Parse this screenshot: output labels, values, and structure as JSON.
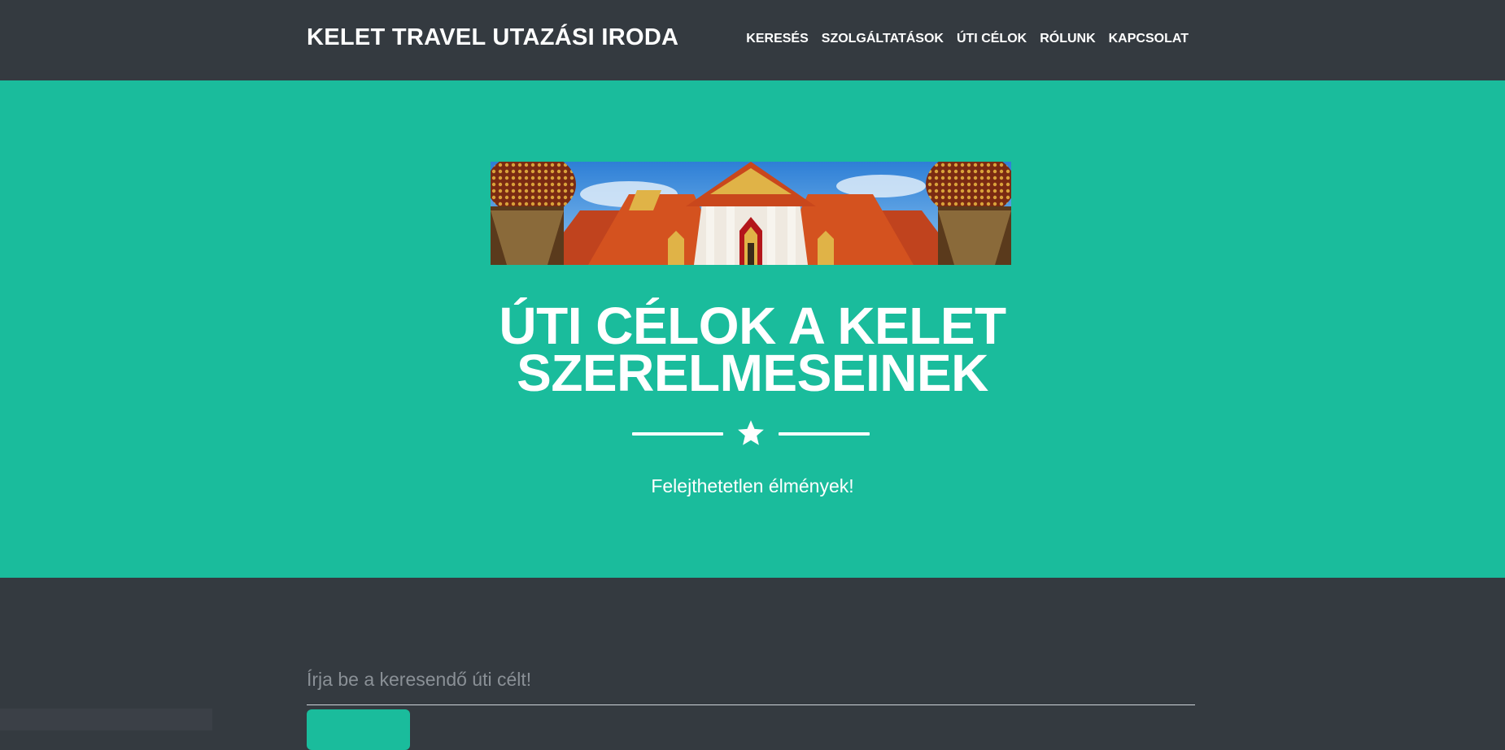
{
  "navbar": {
    "brand": "KELET TRAVEL UTAZÁSI IRODA",
    "links": [
      {
        "label": "KERESÉS"
      },
      {
        "label": "SZOLGÁLTATÁSOK"
      },
      {
        "label": "ÚTI CÉLOK"
      },
      {
        "label": "RÓLUNK"
      },
      {
        "label": "KAPCSOLAT"
      }
    ]
  },
  "masthead": {
    "image_subject": "thai-temple-panorama",
    "title_line1": "ÚTI CÉLOK A KELET",
    "title_line2": "SZERELMESEINEK",
    "divider_icon": "star-icon",
    "subtitle": "Felejthetetlen élmények!"
  },
  "search": {
    "placeholder": "Írja be a keresendő úti célt!",
    "value": "",
    "button_label": ""
  },
  "colors": {
    "primary": "#1abc9c",
    "dark": "#343a40",
    "text_light": "#ffffff"
  }
}
